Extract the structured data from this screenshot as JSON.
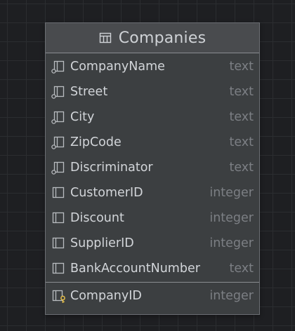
{
  "table": {
    "title": "Companies",
    "columns": [
      {
        "name": "CompanyName",
        "type": "text",
        "icon": "nullable-column-icon"
      },
      {
        "name": "Street",
        "type": "text",
        "icon": "nullable-column-icon"
      },
      {
        "name": "City",
        "type": "text",
        "icon": "nullable-column-icon"
      },
      {
        "name": "ZipCode",
        "type": "text",
        "icon": "nullable-column-icon"
      },
      {
        "name": "Discriminator",
        "type": "text",
        "icon": "nullable-column-icon"
      },
      {
        "name": "CustomerID",
        "type": "integer",
        "icon": "column-icon"
      },
      {
        "name": "Discount",
        "type": "integer",
        "icon": "column-icon"
      },
      {
        "name": "SupplierID",
        "type": "integer",
        "icon": "column-icon"
      },
      {
        "name": "BankAccountNumber",
        "type": "text",
        "icon": "column-icon"
      }
    ],
    "primary_key": {
      "name": "CompanyID",
      "type": "integer",
      "icon": "primary-key-column-icon"
    },
    "colors": {
      "background": "#1e1f22",
      "card": "#3c3f41",
      "header": "#494b4e",
      "text": "#d2d5d9",
      "type_text": "#7c7f84",
      "key": "#e8c14a"
    }
  }
}
